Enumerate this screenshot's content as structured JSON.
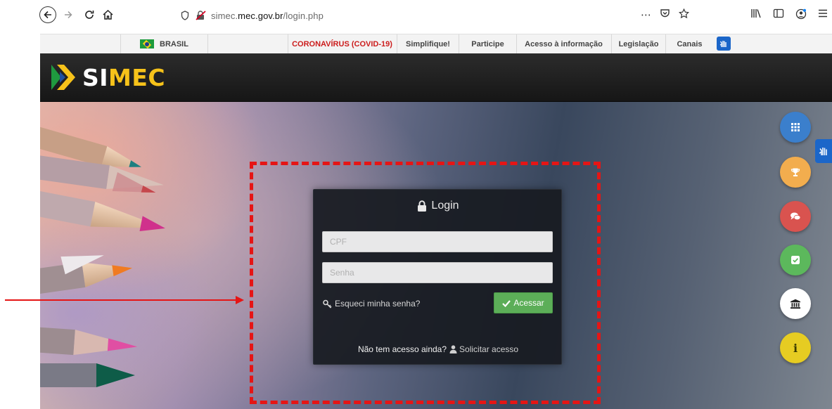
{
  "browser": {
    "url_prefix": "simec.",
    "url_domain": "mec.gov.br",
    "url_path": "/login.php",
    "overflow_glyph": "⋯"
  },
  "govbar": {
    "brasil": "BRASIL",
    "covid": "CORONAVÍRUS (COVID-19)",
    "simplifique": "Simplifique!",
    "participe": "Participe",
    "acesso": "Acesso à informação",
    "legislacao": "Legislação",
    "canais": "Canais"
  },
  "header": {
    "logo_si": "SI",
    "logo_mec": "MEC"
  },
  "login": {
    "title": "Login",
    "cpf_placeholder": "CPF",
    "senha_placeholder": "Senha",
    "forgot": "Esqueci minha senha?",
    "submit": "Acessar",
    "no_access": "Não tem acesso ainda?",
    "request": "Solicitar acesso"
  },
  "fabs": {
    "info": "i"
  },
  "colors": {
    "annotation": "#e51515",
    "submit": "#5cae58",
    "apps": "#3b7fcc",
    "trophy": "#f2ad4e",
    "chat": "#d9534f",
    "check": "#5cb85c",
    "info": "#e6cc22",
    "logo_accent": "#f6c21a"
  }
}
